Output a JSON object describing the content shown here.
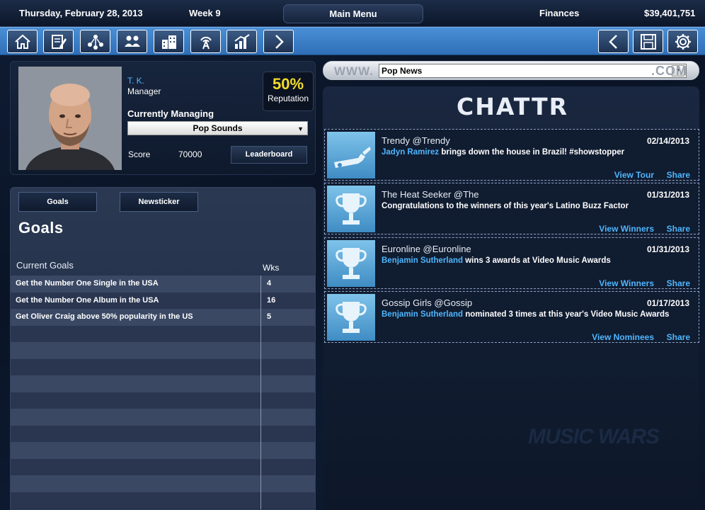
{
  "topbar": {
    "date": "Thursday, February 28, 2013",
    "week": "Week 9",
    "main_menu": "Main Menu",
    "finances_label": "Finances",
    "money": "$39,401,751"
  },
  "toolbar": {
    "left_icons": [
      "home-icon",
      "edit-icon",
      "network-icon",
      "people-icon",
      "building-icon",
      "broadcast-icon",
      "chart-icon",
      "arrow-right-icon"
    ],
    "right_icons": [
      "arrow-left-icon",
      "save-icon",
      "gear-icon"
    ],
    "accent": "#3a82cc"
  },
  "profile": {
    "name": "T. K.",
    "role": "Manager",
    "reputation_value": "50%",
    "reputation_label": "Reputation",
    "managing_label": "Currently Managing",
    "managing_value": "Pop Sounds",
    "score_label": "Score",
    "score_value": "70000",
    "leaderboard": "Leaderboard"
  },
  "goals": {
    "tab_goals": "Goals",
    "tab_newsticker": "Newsticker",
    "title": "Goals",
    "col_current": "Current Goals",
    "col_wks": "Wks",
    "rows": [
      {
        "desc": "Get the Number One Single in the USA",
        "wks": "4"
      },
      {
        "desc": "Get the Number One Album in the USA",
        "wks": "16"
      },
      {
        "desc": "Get Oliver Craig above 50% popularity in the US",
        "wks": "5"
      },
      {
        "desc": "",
        "wks": ""
      },
      {
        "desc": "",
        "wks": ""
      },
      {
        "desc": "",
        "wks": ""
      },
      {
        "desc": "",
        "wks": ""
      },
      {
        "desc": "",
        "wks": ""
      },
      {
        "desc": "",
        "wks": ""
      },
      {
        "desc": "",
        "wks": ""
      },
      {
        "desc": "",
        "wks": ""
      },
      {
        "desc": "",
        "wks": ""
      },
      {
        "desc": "",
        "wks": ""
      },
      {
        "desc": "",
        "wks": ""
      }
    ]
  },
  "browser": {
    "www": "WWW.",
    "url": "Pop News",
    "dotcom": ".COM"
  },
  "feed": {
    "logo": "CHATTR",
    "posts": [
      {
        "thumb": "guitar-icon",
        "author": "Trendy @Trendy",
        "date": "02/14/2013",
        "link": "Jadyn Ramirez",
        "text": " brings down the house in Brazil! #showstopper",
        "action": "View Tour",
        "share": "Share"
      },
      {
        "thumb": "trophy-icon",
        "author": "The Heat Seeker @The",
        "date": "01/31/2013",
        "link": "",
        "text": "Congratulations to the winners of this year's Latino Buzz Factor",
        "action": "View Winners",
        "share": "Share"
      },
      {
        "thumb": "trophy-icon",
        "author": "Euronline @Euronline",
        "date": "01/31/2013",
        "link": "Benjamin Sutherland",
        "text": " wins 3 awards at Video Music Awards",
        "action": "View Winners",
        "share": "Share"
      },
      {
        "thumb": "trophy-icon",
        "author": "Gossip Girls @Gossip",
        "date": "01/17/2013",
        "link": "Benjamin Sutherland",
        "text": " nominated 3 times at this year's Video Music Awards",
        "action": "View Nominees",
        "share": "Share"
      }
    ]
  }
}
